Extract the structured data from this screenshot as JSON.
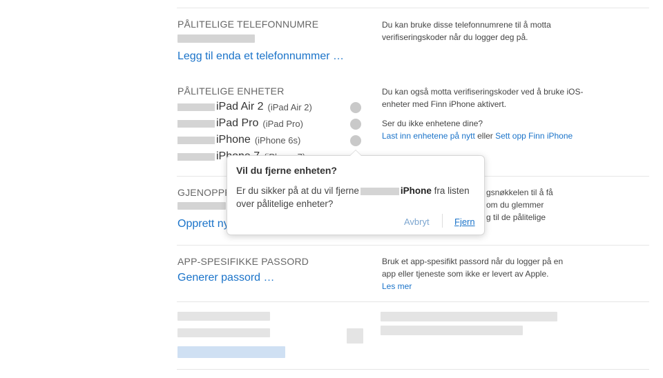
{
  "phones": {
    "title": "PÅLITELIGE TELEFONNUMRE",
    "description": "Du kan bruke disse telefonnumrene til å motta verifiseringskoder når du logger deg på.",
    "add_link": "Legg til enda et telefonnummer …"
  },
  "devices": {
    "title": "PÅLITELIGE ENHETER",
    "description": "Du kan også motta verifiseringskoder ved å bruke iOS-enheter med Finn iPhone aktivert.",
    "missing_question": "Ser du ikke enhetene dine?",
    "reload_link": "Last inn enhetene på nytt",
    "or_text": " eller ",
    "setup_link": "Sett opp Finn iPhone",
    "list": [
      {
        "name": "iPad Air 2",
        "model": "(iPad Air 2)"
      },
      {
        "name": "iPad Pro",
        "model": "(iPad Pro)"
      },
      {
        "name": "iPhone",
        "model": "(iPhone 6s)"
      },
      {
        "name": "iPhone 7",
        "model": "(iPhone 7)"
      }
    ]
  },
  "recovery": {
    "title_partial": "GJENOPPRE",
    "description_lines": [
      "gsnøkkelen til å få",
      "om du glemmer",
      "g til de pålitelige"
    ],
    "link_partial": "Opprett ny"
  },
  "app_passwords": {
    "title": "APP-SPESIFIKKE PASSORD",
    "description": "Bruk et app-spesifikt passord når du logger på en app eller tjeneste som ikke er levert av Apple.",
    "learn_more": "Les mer",
    "generate_link": "Generer passord …"
  },
  "dialog": {
    "title": "Vil du fjerne enheten?",
    "body_prefix": "Er du sikker på at du vil fjerne",
    "device": "iPhone",
    "body_suffix": "fra listen over pålitelige enheter?",
    "cancel": "Avbryt",
    "confirm": "Fjern"
  }
}
